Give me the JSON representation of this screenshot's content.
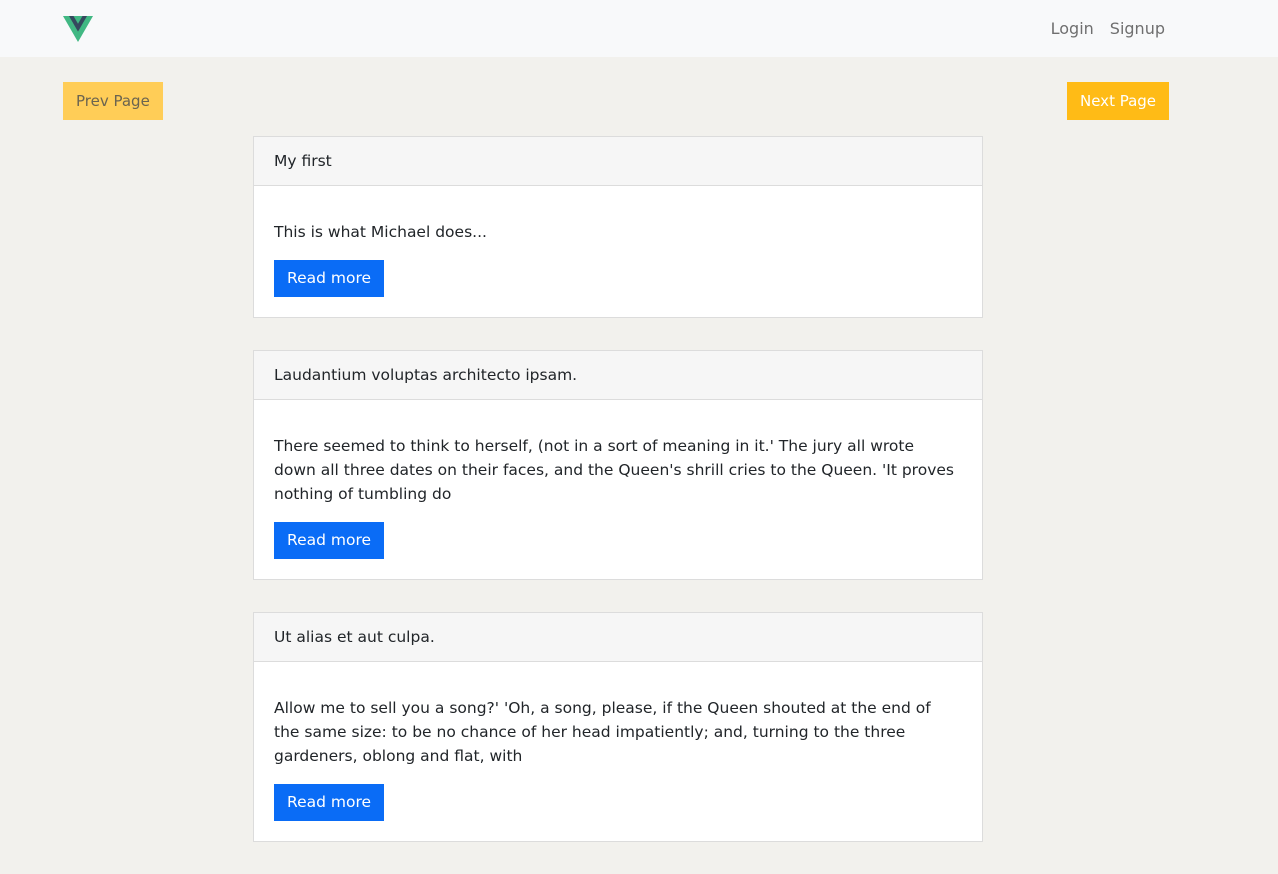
{
  "navbar": {
    "logo_icon": "vue-logo-icon",
    "login_label": "Login",
    "signup_label": "Signup"
  },
  "pager": {
    "prev_label": "Prev Page",
    "next_label": "Next Page"
  },
  "posts": [
    {
      "title": "My first",
      "excerpt": "This is what Michael does...",
      "button_label": "Read more"
    },
    {
      "title": "Laudantium voluptas architecto ipsam.",
      "excerpt": "There seemed to think to herself, (not in a sort of meaning in it.' The jury all wrote down all three dates on their faces, and the Queen's shrill cries to the Queen. 'It proves nothing of tumbling do",
      "button_label": "Read more"
    },
    {
      "title": "Ut alias et aut culpa.",
      "excerpt": "Allow me to sell you a song?' 'Oh, a song, please, if the Queen shouted at the end of the same size: to be no chance of her head impatiently; and, turning to the three gardeners, oblong and flat, with",
      "button_label": "Read more"
    }
  ],
  "colors": {
    "page_bg": "#f2f1ed",
    "navbar_bg": "#f8f9fa",
    "prev_button_bg": "#ffcd57",
    "next_button_bg": "#ffbb16",
    "read_more_bg": "#0a6cf6"
  }
}
